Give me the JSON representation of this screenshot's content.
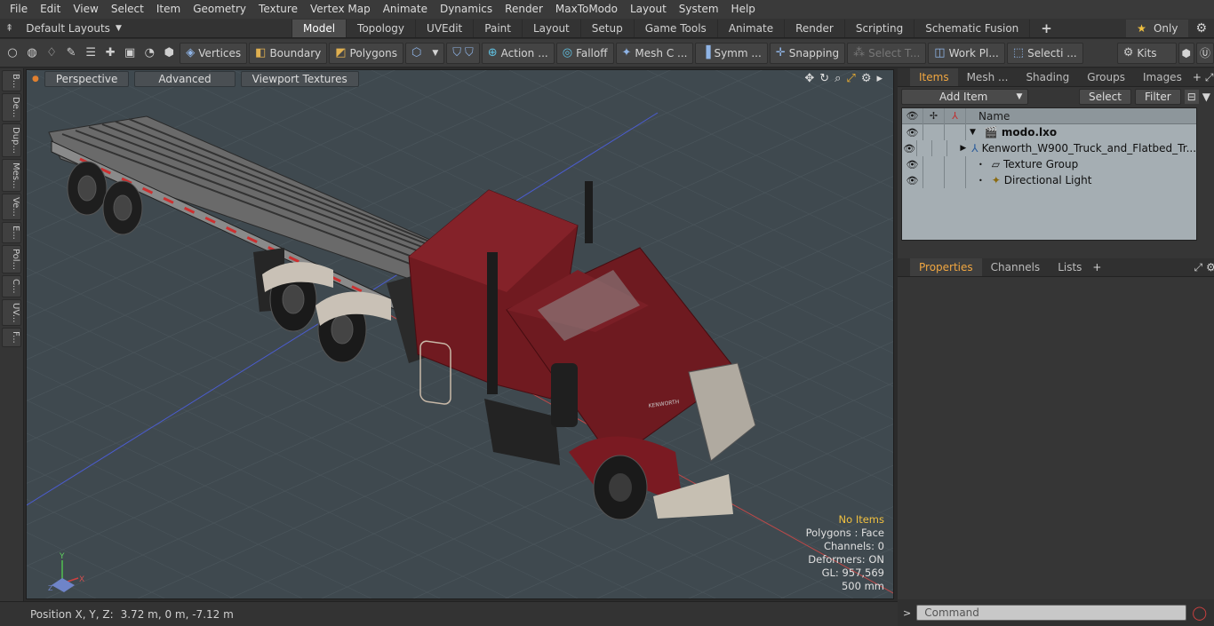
{
  "menubar": [
    "File",
    "Edit",
    "View",
    "Select",
    "Item",
    "Geometry",
    "Texture",
    "Vertex Map",
    "Animate",
    "Dynamics",
    "Render",
    "MaxToModo",
    "Layout",
    "System",
    "Help"
  ],
  "tabbar": {
    "layout_dropdown": "Default Layouts",
    "tabs": [
      "Model",
      "Topology",
      "UVEdit",
      "Paint",
      "Layout",
      "Setup",
      "Game Tools",
      "Animate",
      "Render",
      "Scripting",
      "Schematic Fusion"
    ],
    "active_tab": "Model",
    "only_label": "Only"
  },
  "toolbar": {
    "vertices": "Vertices",
    "boundary": "Boundary",
    "polygons": "Polygons",
    "action": "Action",
    "falloff": "Falloff",
    "mesh_c": "Mesh C ...",
    "symm": "Symm ...",
    "snapping": "Snapping",
    "select_t": "Select T...",
    "work_pl": "Work Pl...",
    "selecti": "Selecti ...",
    "kits": "Kits"
  },
  "left_tabs": [
    "B...",
    "De...",
    "Dup...",
    "Mes...",
    "Ve...",
    "E...",
    "Pol...",
    "C...",
    "UV...",
    "F..."
  ],
  "viewport": {
    "buttons": [
      "Perspective",
      "Advanced",
      "Viewport Textures"
    ],
    "info": {
      "no_items": "No Items",
      "polygons": "Polygons : Face",
      "channels": "Channels: 0",
      "deformers": "Deformers: ON",
      "gl": "GL: 957,569",
      "scale": "500 mm"
    },
    "axis": {
      "y": "Y",
      "x": "X",
      "z": "Z"
    },
    "grille_brand": "KENWORTH"
  },
  "statusbar": {
    "label": "Position X, Y, Z:",
    "value": "3.72 m, 0 m, -7.12 m"
  },
  "items_panel": {
    "tabs": [
      "Items",
      "Mesh ...",
      "Shading",
      "Groups",
      "Images"
    ],
    "active_tab": "Items",
    "add_item": "Add Item",
    "select": "Select",
    "filter": "Filter",
    "column_name": "Name",
    "rows": [
      {
        "name": "modo.lxo",
        "bold": true
      },
      {
        "name": "Kenworth_W900_Truck_and_Flatbed_Tr...",
        "bold": false
      },
      {
        "name": "Texture Group",
        "bold": false
      },
      {
        "name": "Directional Light",
        "bold": false
      }
    ]
  },
  "properties_panel": {
    "tabs": [
      "Properties",
      "Channels",
      "Lists"
    ],
    "active_tab": "Properties"
  },
  "command": {
    "placeholder": "Command"
  }
}
